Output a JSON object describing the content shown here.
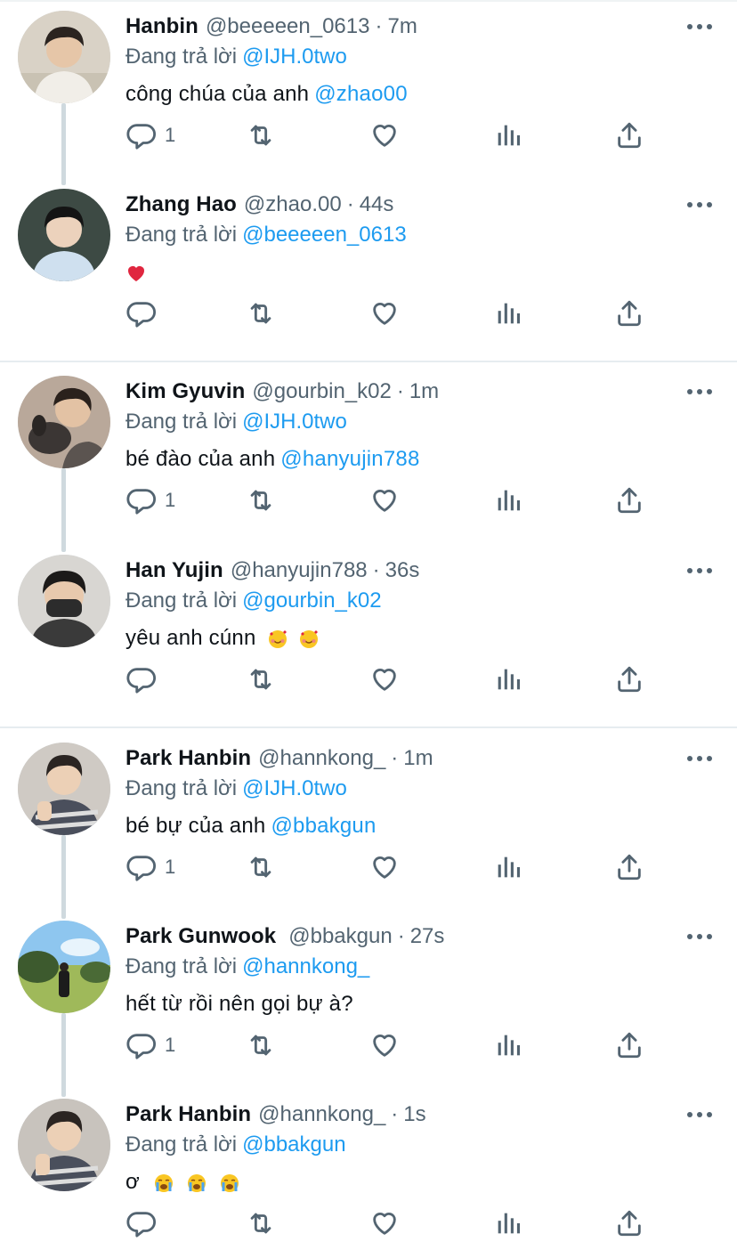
{
  "reply_prefix": "Đang trả lời",
  "colors": {
    "link": "#1d9bf0",
    "secondary": "#536471",
    "text": "#0f1419",
    "divider": "#e6ecf0",
    "thread_line": "#cfd9de"
  },
  "icons": [
    "reply-icon",
    "retweet-icon",
    "like-icon",
    "analytics-icon",
    "share-icon",
    "more-icon",
    "heart-emoji",
    "smiling-face-with-hearts-emoji",
    "loudly-crying-face-emoji"
  ],
  "tweets": [
    {
      "name": "Hanbin",
      "handle": "@beeeeen_0613",
      "time": "7m",
      "reply_to": "@IJH.0two",
      "text": "công chúa của anh",
      "mention": "@zhao00",
      "reply_count": "1"
    },
    {
      "name": "Zhang Hao",
      "handle": "@zhao.00",
      "time": "44s",
      "reply_to": "@beeeeen_0613",
      "text": "",
      "mention": "",
      "reply_count": ""
    },
    {
      "name": "Kim Gyuvin",
      "handle": "@gourbin_k02",
      "time": "1m",
      "reply_to": "@IJH.0two",
      "text": "bé đào của anh",
      "mention": "@hanyujin788",
      "reply_count": "1"
    },
    {
      "name": "Han Yujin",
      "handle": "@hanyujin788",
      "time": "36s",
      "reply_to": "@gourbin_k02",
      "text": "yêu anh cúnn",
      "mention": "",
      "reply_count": ""
    },
    {
      "name": "Park Hanbin",
      "handle": "@hannkong_",
      "time": "1m",
      "reply_to": "@IJH.0two",
      "text": "bé bự của anh",
      "mention": "@bbakgun",
      "reply_count": "1"
    },
    {
      "name": "Park Gunwook",
      "handle": "@bbakgun",
      "time": "27s",
      "reply_to": "@hannkong_",
      "text": "hết từ rồi nên gọi bự à?",
      "mention": "",
      "reply_count": "1"
    },
    {
      "name": "Park Hanbin",
      "handle": "@hannkong_",
      "time": "1s",
      "reply_to": "@bbakgun",
      "text": "ơ",
      "mention": "",
      "reply_count": ""
    }
  ]
}
